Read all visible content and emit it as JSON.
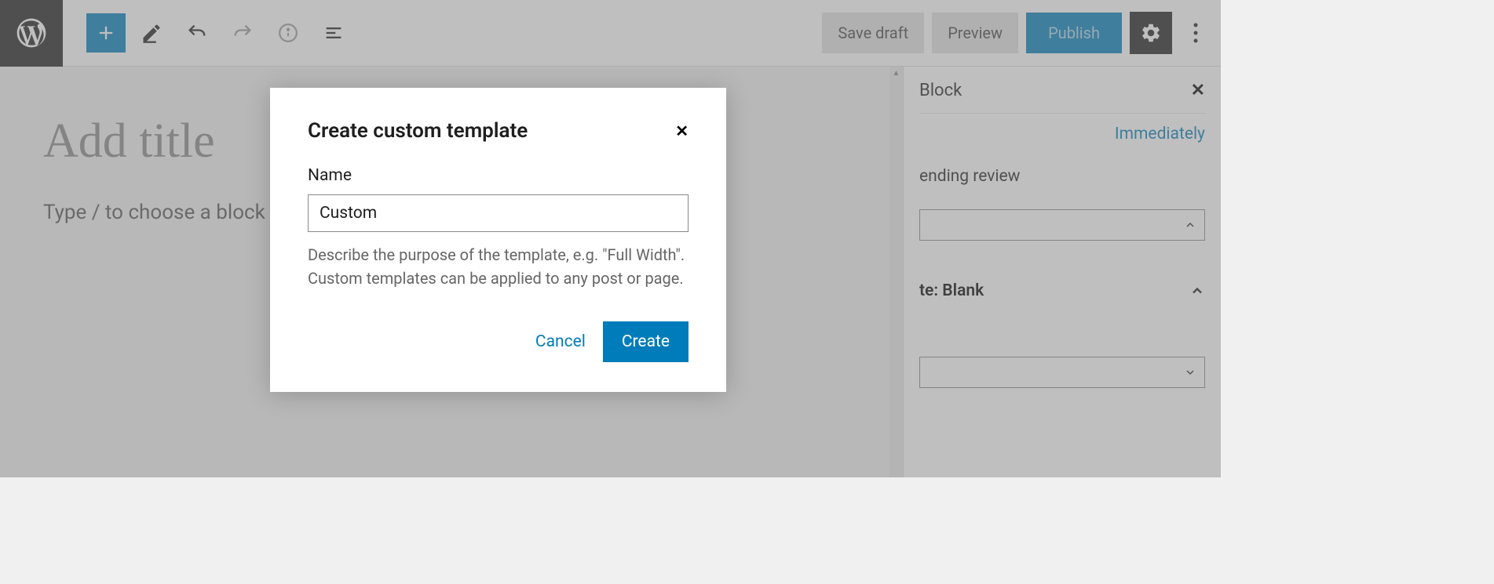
{
  "toolbar": {
    "save_draft": "Save draft",
    "preview": "Preview",
    "publish": "Publish"
  },
  "editor": {
    "title_placeholder": "Add title",
    "body_placeholder": "Type / to choose a block"
  },
  "sidebar": {
    "tab_block": "Block",
    "immediately": "Immediately",
    "pending_review": "ending review",
    "template": "te: Blank"
  },
  "modal": {
    "title": "Create custom template",
    "name_label": "Name",
    "name_value": "Custom",
    "help_text": "Describe the purpose of the template, e.g. \"Full Width\". Custom templates can be applied to any post or page.",
    "cancel": "Cancel",
    "create": "Create"
  }
}
